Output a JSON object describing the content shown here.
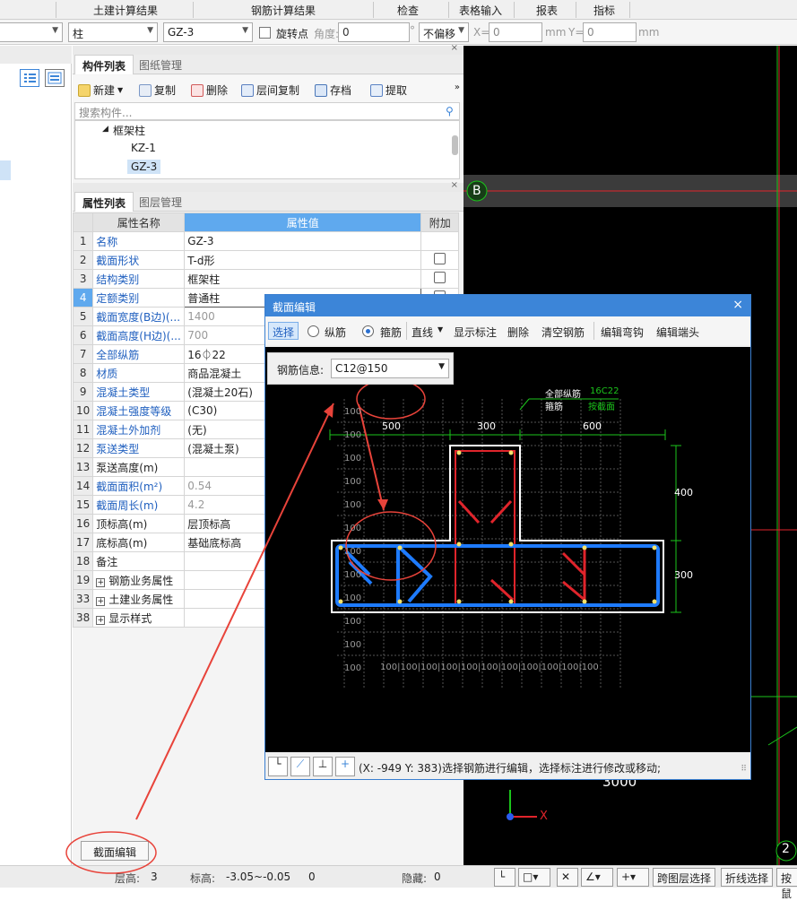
{
  "menubar": {
    "items": [
      "土建计算结果",
      "钢筋计算结果",
      "检查",
      "表格输入",
      "报表",
      "指标"
    ]
  },
  "toolbar2": {
    "type_value": "柱",
    "component_value": "GZ-3",
    "rotate_label": "旋转点",
    "angle_label": "角度:",
    "angle_value": "0",
    "degree": "°",
    "offset_value": "不偏移",
    "x_label": "X=",
    "x_value": "0",
    "mm1": "mm",
    "y_label": "Y=",
    "y_value": "0",
    "mm2": "mm"
  },
  "component_panel": {
    "tab_active": "构件列表",
    "tab_inactive": "图纸管理",
    "buttons": [
      "新建",
      "复制",
      "删除",
      "层间复制",
      "存档",
      "提取"
    ],
    "search_placeholder": "搜索构件...",
    "tree": {
      "group": "框架柱",
      "items": [
        "KZ-1",
        "GZ-3"
      ]
    }
  },
  "property_panel": {
    "tab_active": "属性列表",
    "tab_inactive": "图层管理",
    "headers": {
      "name": "属性名称",
      "value": "属性值",
      "extra": "附加"
    },
    "rows": [
      {
        "n": "1",
        "k": "名称",
        "v": "GZ-3"
      },
      {
        "n": "2",
        "k": "截面形状",
        "v": "T-d形"
      },
      {
        "n": "3",
        "k": "结构类别",
        "v": "框架柱"
      },
      {
        "n": "4",
        "k": "定额类别",
        "v": "普通柱"
      },
      {
        "n": "5",
        "k": "截面宽度(B边)(...",
        "v": "1400"
      },
      {
        "n": "6",
        "k": "截面高度(H边)(...",
        "v": "700"
      },
      {
        "n": "7",
        "k": "全部纵筋",
        "v": "16⏀22"
      },
      {
        "n": "8",
        "k": "材质",
        "v": "商品混凝土"
      },
      {
        "n": "9",
        "k": "混凝土类型",
        "v": "(混凝土20石)"
      },
      {
        "n": "10",
        "k": "混凝土强度等级",
        "v": "(C30)"
      },
      {
        "n": "11",
        "k": "混凝土外加剂",
        "v": "(无)"
      },
      {
        "n": "12",
        "k": "泵送类型",
        "v": "(混凝土泵)"
      },
      {
        "n": "13",
        "k": "泵送高度(m)",
        "v": ""
      },
      {
        "n": "14",
        "k": "截面面积(m²)",
        "v": "0.54"
      },
      {
        "n": "15",
        "k": "截面周长(m)",
        "v": "4.2"
      },
      {
        "n": "16",
        "k": "顶标高(m)",
        "v": "层顶标高"
      },
      {
        "n": "17",
        "k": "底标高(m)",
        "v": "基础底标高"
      },
      {
        "n": "18",
        "k": "备注",
        "v": ""
      },
      {
        "n": "19",
        "k": "钢筋业务属性",
        "v": ""
      },
      {
        "n": "33",
        "k": "土建业务属性",
        "v": ""
      },
      {
        "n": "38",
        "k": "显示样式",
        "v": ""
      }
    ],
    "section_edit_button": "截面编辑"
  },
  "canvas": {
    "axis_label": "B",
    "axis_label2": "2",
    "dim": "3000",
    "x_axis": "X"
  },
  "dialog": {
    "title": "截面编辑",
    "tools": [
      "选择",
      "纵筋",
      "箍筋",
      "直线",
      "显示标注",
      "删除",
      "清空钢筋",
      "编辑弯钩",
      "编辑端头"
    ],
    "rebar_info_label": "钢筋信息:",
    "rebar_info_value": "C12@150",
    "annot_all": "全部纵筋",
    "annot_all_val": "16C22",
    "annot_stirrup": "箍筋",
    "annot_stirrup_val": "按截面",
    "dims_top": [
      "500",
      "300",
      "600"
    ],
    "dims_right": [
      "400",
      "300"
    ],
    "grid_label": "100",
    "status_text": "(X: -949 Y: 383)选择钢筋进行编辑，选择标注进行修改或移动;"
  },
  "statusbar": {
    "floor_label": "层高:",
    "floor_value": "3",
    "elev_label": "标高:",
    "elev_value": "-3.05~-0.05",
    "zero": "0",
    "hidden_label": "隐藏:",
    "hidden_value": "0",
    "btn1": "跨图层选择",
    "btn2": "折线选择",
    "btn3": "按鼠"
  },
  "colors": {
    "accent": "#3c85d8",
    "rebar_blue": "#1e7bff",
    "rebar_red": "#e0242b",
    "annotation_red": "#e8433a"
  }
}
